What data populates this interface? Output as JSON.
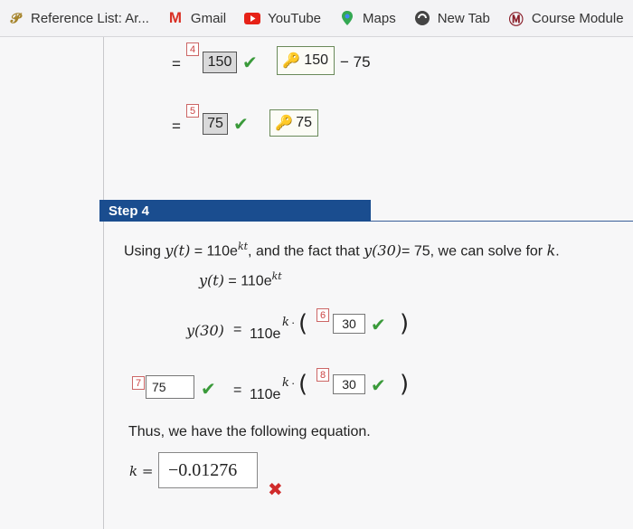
{
  "bookmarks": [
    {
      "label": "Reference List: Ar...",
      "icon": "reference-icon"
    },
    {
      "label": "Gmail",
      "icon": "gmail-icon"
    },
    {
      "label": "YouTube",
      "icon": "youtube-icon"
    },
    {
      "label": "Maps",
      "icon": "maps-icon"
    },
    {
      "label": "New Tab",
      "icon": "newtab-icon"
    },
    {
      "label": "Course Module",
      "icon": "course-icon"
    }
  ],
  "row1": {
    "eq": "=",
    "badge": "4",
    "value": "150",
    "key_value": "150",
    "minus": "− 75"
  },
  "row2": {
    "eq": "=",
    "badge": "5",
    "value": "75",
    "key_value": "75"
  },
  "step": {
    "title": "Step 4",
    "intro_a": "Using ",
    "intro_y": "y(t)",
    "intro_b": " = 110e",
    "intro_exp": "kt",
    "intro_c": ", and the fact that ",
    "intro_y30": "y(30)",
    "intro_d": "= 75, we can solve for ",
    "intro_k": "k",
    "intro_e": ".",
    "eq1_lhs": "y(t)",
    "eq1_rhs": "=  110e",
    "eq1_exp": "kt",
    "eq2_lhs": "y(30)",
    "eq2_eq": "=",
    "eq2_base": "110e",
    "eq2_exp": "k",
    "eq2_dot": "·",
    "eq2_badge": "6",
    "eq2_value": "30",
    "eq3_badge": "7",
    "eq3_value": "75",
    "eq3_eq": "=",
    "eq3_base": "110e",
    "eq3_exp": "k",
    "eq3_dot": "·",
    "eq3_badge2": "8",
    "eq3_value2": "30",
    "thus": "Thus, we have the following equation.",
    "k_label": "k =",
    "k_value": "−0.01276"
  },
  "colors": {
    "step_header": "#1a4d8f",
    "check": "#3a9a3a",
    "wrong": "#d02b2b"
  }
}
